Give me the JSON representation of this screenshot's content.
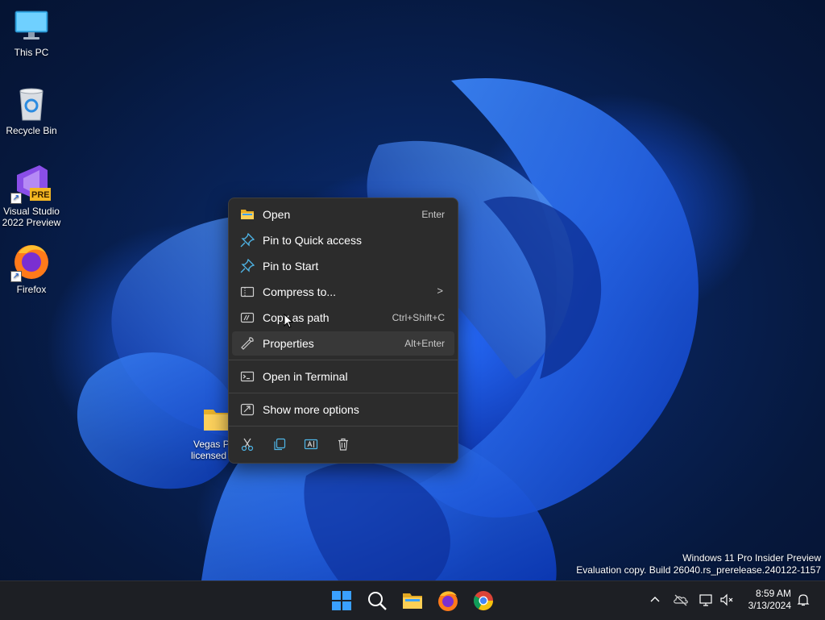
{
  "desktop": {
    "icons": [
      {
        "label": "This PC"
      },
      {
        "label": "Recycle Bin"
      },
      {
        "label_line1": "Visual Studio",
        "label_line2": "2022 Preview",
        "badge": "PRE"
      },
      {
        "label": "Firefox"
      },
      {
        "label_line1": "Vegas Pr",
        "label_line2": "licensed ....."
      }
    ]
  },
  "context_menu": {
    "items": [
      {
        "label": "Open",
        "shortcut": "Enter",
        "icon": "folder-open-icon"
      },
      {
        "label": "Pin to Quick access",
        "icon": "pin-icon"
      },
      {
        "label": "Pin to Start",
        "icon": "pin-icon"
      },
      {
        "label": "Compress to...",
        "icon": "zip-icon",
        "submenu_glyph": ">"
      },
      {
        "label": "Copy as path",
        "shortcut": "Ctrl+Shift+C",
        "icon": "copy-path-icon"
      },
      {
        "label": "Properties",
        "shortcut": "Alt+Enter",
        "icon": "wrench-icon"
      },
      {
        "label": "Open in Terminal",
        "icon": "terminal-icon"
      },
      {
        "label": "Show more options",
        "icon": "more-options-icon"
      }
    ],
    "bottom_bar": [
      "cut-icon",
      "copy-icon",
      "rename-icon",
      "delete-icon"
    ]
  },
  "watermark": {
    "line1": "Windows 11 Pro Insider Preview",
    "line2": "Evaluation copy. Build 26040.rs_prerelease.240122-1157"
  },
  "taskbar": {
    "apps": [
      "start-icon",
      "search-icon",
      "file-explorer-icon",
      "firefox-icon",
      "chrome-icon"
    ],
    "tray": [
      "chevron-up-icon",
      "onedrive-icon",
      "network-icon",
      "volume-muted-icon",
      "notification-bell-icon"
    ],
    "time": "8:59 AM",
    "date": "3/13/2024"
  },
  "colors": {
    "menu_bg": "#2c2c2c",
    "menu_hover": "#383838",
    "taskbar_bg": "#1d1f24",
    "accent": "#3aa0ff"
  }
}
